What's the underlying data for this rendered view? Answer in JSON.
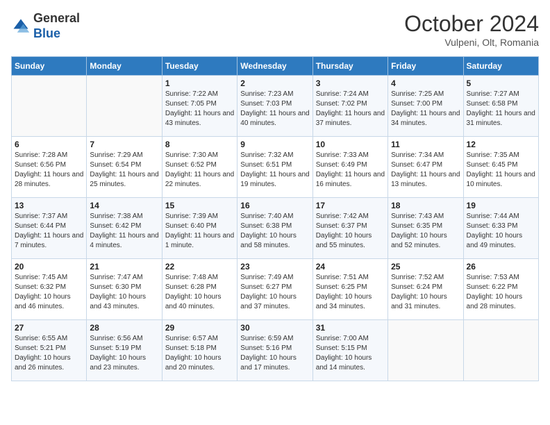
{
  "header": {
    "logo_line1": "General",
    "logo_line2": "Blue",
    "month": "October 2024",
    "location": "Vulpeni, Olt, Romania"
  },
  "days_of_week": [
    "Sunday",
    "Monday",
    "Tuesday",
    "Wednesday",
    "Thursday",
    "Friday",
    "Saturday"
  ],
  "weeks": [
    [
      {
        "day": "",
        "info": ""
      },
      {
        "day": "",
        "info": ""
      },
      {
        "day": "1",
        "info": "Sunrise: 7:22 AM\nSunset: 7:05 PM\nDaylight: 11 hours and 43 minutes."
      },
      {
        "day": "2",
        "info": "Sunrise: 7:23 AM\nSunset: 7:03 PM\nDaylight: 11 hours and 40 minutes."
      },
      {
        "day": "3",
        "info": "Sunrise: 7:24 AM\nSunset: 7:02 PM\nDaylight: 11 hours and 37 minutes."
      },
      {
        "day": "4",
        "info": "Sunrise: 7:25 AM\nSunset: 7:00 PM\nDaylight: 11 hours and 34 minutes."
      },
      {
        "day": "5",
        "info": "Sunrise: 7:27 AM\nSunset: 6:58 PM\nDaylight: 11 hours and 31 minutes."
      }
    ],
    [
      {
        "day": "6",
        "info": "Sunrise: 7:28 AM\nSunset: 6:56 PM\nDaylight: 11 hours and 28 minutes."
      },
      {
        "day": "7",
        "info": "Sunrise: 7:29 AM\nSunset: 6:54 PM\nDaylight: 11 hours and 25 minutes."
      },
      {
        "day": "8",
        "info": "Sunrise: 7:30 AM\nSunset: 6:52 PM\nDaylight: 11 hours and 22 minutes."
      },
      {
        "day": "9",
        "info": "Sunrise: 7:32 AM\nSunset: 6:51 PM\nDaylight: 11 hours and 19 minutes."
      },
      {
        "day": "10",
        "info": "Sunrise: 7:33 AM\nSunset: 6:49 PM\nDaylight: 11 hours and 16 minutes."
      },
      {
        "day": "11",
        "info": "Sunrise: 7:34 AM\nSunset: 6:47 PM\nDaylight: 11 hours and 13 minutes."
      },
      {
        "day": "12",
        "info": "Sunrise: 7:35 AM\nSunset: 6:45 PM\nDaylight: 11 hours and 10 minutes."
      }
    ],
    [
      {
        "day": "13",
        "info": "Sunrise: 7:37 AM\nSunset: 6:44 PM\nDaylight: 11 hours and 7 minutes."
      },
      {
        "day": "14",
        "info": "Sunrise: 7:38 AM\nSunset: 6:42 PM\nDaylight: 11 hours and 4 minutes."
      },
      {
        "day": "15",
        "info": "Sunrise: 7:39 AM\nSunset: 6:40 PM\nDaylight: 11 hours and 1 minute."
      },
      {
        "day": "16",
        "info": "Sunrise: 7:40 AM\nSunset: 6:38 PM\nDaylight: 10 hours and 58 minutes."
      },
      {
        "day": "17",
        "info": "Sunrise: 7:42 AM\nSunset: 6:37 PM\nDaylight: 10 hours and 55 minutes."
      },
      {
        "day": "18",
        "info": "Sunrise: 7:43 AM\nSunset: 6:35 PM\nDaylight: 10 hours and 52 minutes."
      },
      {
        "day": "19",
        "info": "Sunrise: 7:44 AM\nSunset: 6:33 PM\nDaylight: 10 hours and 49 minutes."
      }
    ],
    [
      {
        "day": "20",
        "info": "Sunrise: 7:45 AM\nSunset: 6:32 PM\nDaylight: 10 hours and 46 minutes."
      },
      {
        "day": "21",
        "info": "Sunrise: 7:47 AM\nSunset: 6:30 PM\nDaylight: 10 hours and 43 minutes."
      },
      {
        "day": "22",
        "info": "Sunrise: 7:48 AM\nSunset: 6:28 PM\nDaylight: 10 hours and 40 minutes."
      },
      {
        "day": "23",
        "info": "Sunrise: 7:49 AM\nSunset: 6:27 PM\nDaylight: 10 hours and 37 minutes."
      },
      {
        "day": "24",
        "info": "Sunrise: 7:51 AM\nSunset: 6:25 PM\nDaylight: 10 hours and 34 minutes."
      },
      {
        "day": "25",
        "info": "Sunrise: 7:52 AM\nSunset: 6:24 PM\nDaylight: 10 hours and 31 minutes."
      },
      {
        "day": "26",
        "info": "Sunrise: 7:53 AM\nSunset: 6:22 PM\nDaylight: 10 hours and 28 minutes."
      }
    ],
    [
      {
        "day": "27",
        "info": "Sunrise: 6:55 AM\nSunset: 5:21 PM\nDaylight: 10 hours and 26 minutes."
      },
      {
        "day": "28",
        "info": "Sunrise: 6:56 AM\nSunset: 5:19 PM\nDaylight: 10 hours and 23 minutes."
      },
      {
        "day": "29",
        "info": "Sunrise: 6:57 AM\nSunset: 5:18 PM\nDaylight: 10 hours and 20 minutes."
      },
      {
        "day": "30",
        "info": "Sunrise: 6:59 AM\nSunset: 5:16 PM\nDaylight: 10 hours and 17 minutes."
      },
      {
        "day": "31",
        "info": "Sunrise: 7:00 AM\nSunset: 5:15 PM\nDaylight: 10 hours and 14 minutes."
      },
      {
        "day": "",
        "info": ""
      },
      {
        "day": "",
        "info": ""
      }
    ]
  ]
}
